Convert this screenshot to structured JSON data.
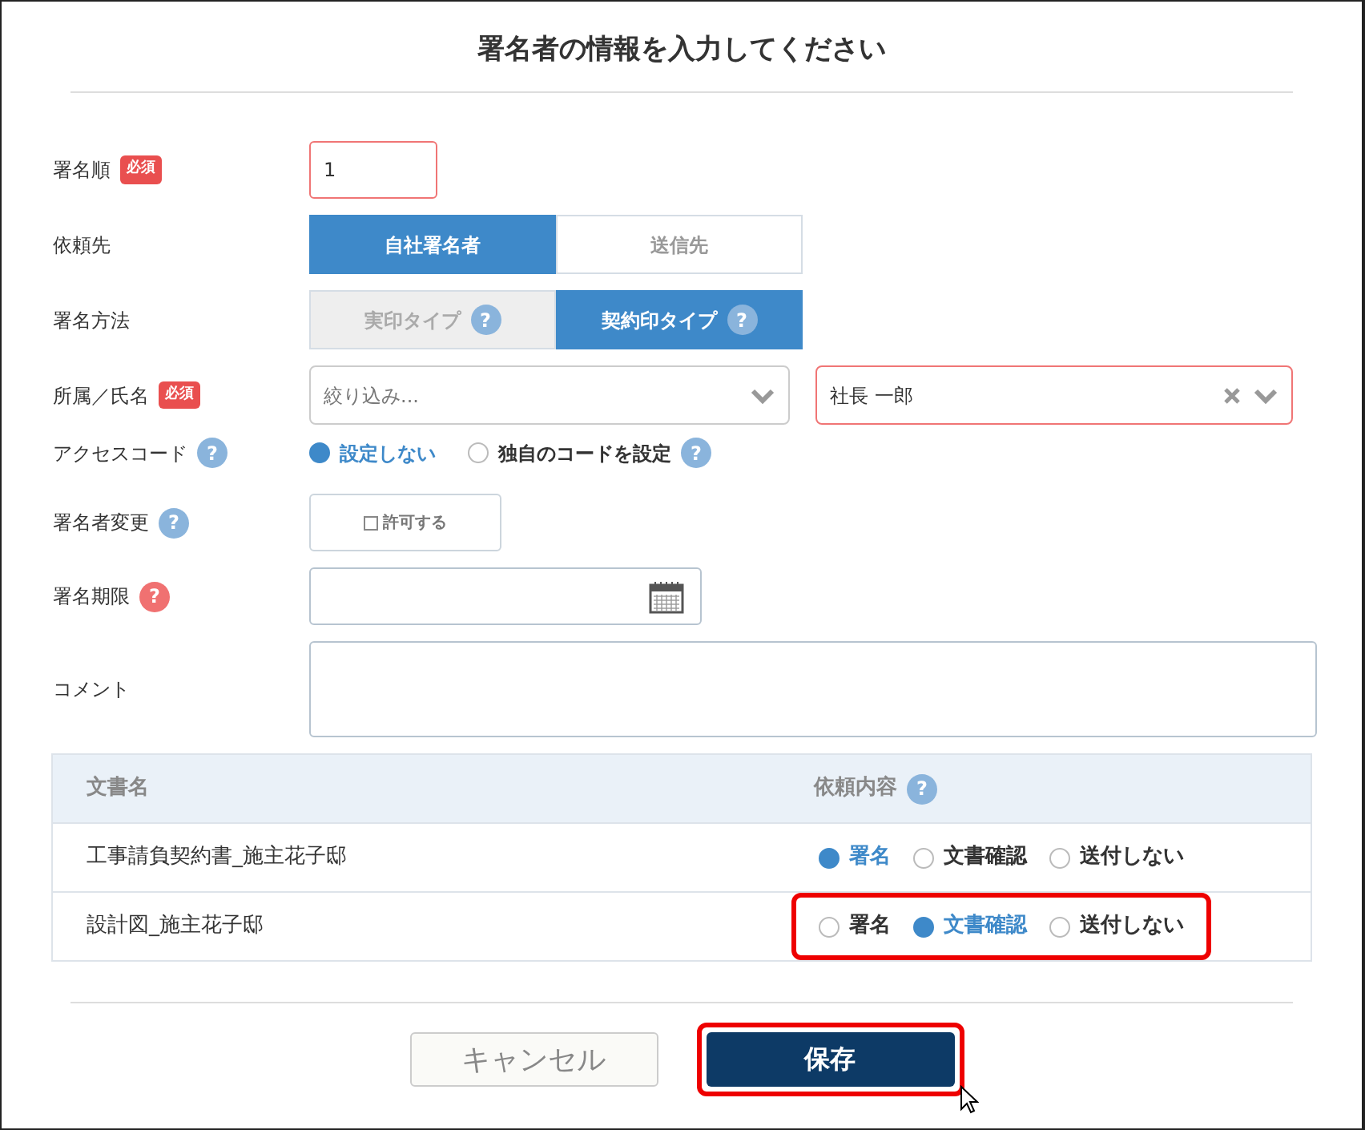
{
  "title": "署名者の情報を入力してください",
  "fields": [
    {
      "kind": "text",
      "label": "署名順",
      "required_label": "必須",
      "value": "1",
      "error": true
    },
    {
      "kind": "segmented",
      "label": "依頼先",
      "options": [
        {
          "label": "自社署名者",
          "selected": true
        },
        {
          "label": "送信先",
          "selected": false
        }
      ]
    },
    {
      "kind": "segmented",
      "label": "署名方法",
      "options": [
        {
          "label": "実印タイプ",
          "selected": false,
          "help": {
            "text": "?",
            "color": "#8ab4dc"
          }
        },
        {
          "label": "契約印タイプ",
          "selected": true,
          "help": {
            "text": "?",
            "color": "#8ab4dc"
          }
        }
      ]
    },
    {
      "kind": "selects",
      "label": "所属／氏名",
      "required_label": "必須",
      "selects": [
        {
          "placeholder": "絞り込み...",
          "error": false,
          "clearable": false
        },
        {
          "value": "社長 一郎",
          "error": true,
          "clearable": true
        }
      ]
    },
    {
      "kind": "radio",
      "label": "アクセスコード",
      "help": {
        "text": "?",
        "color": "#8ab4dc"
      },
      "options": [
        {
          "label": "設定しない",
          "selected": true
        },
        {
          "label": "独自のコードを設定",
          "selected": false,
          "help": {
            "text": "?",
            "color": "#8ab4dc"
          }
        }
      ]
    },
    {
      "kind": "checkbox",
      "label": "署名者変更",
      "help": {
        "text": "?",
        "color": "#8ab4dc"
      },
      "checkbox": {
        "label": "許可する",
        "checked": false
      }
    },
    {
      "kind": "date",
      "label": "署名期限",
      "help": {
        "text": "?",
        "color": "#f07171"
      }
    },
    {
      "kind": "textarea",
      "label": "コメント"
    }
  ],
  "documents": {
    "columns": [
      {
        "label": "文書名"
      },
      {
        "label": "依頼内容",
        "help": {
          "text": "?",
          "color": "#8ab4dc"
        }
      }
    ],
    "rows": [
      {
        "name": "工事請負契約書_施主花子邸",
        "highlighted": false,
        "options": [
          {
            "label": "署名",
            "selected": true
          },
          {
            "label": "文書確認",
            "selected": false
          },
          {
            "label": "送付しない",
            "selected": false
          }
        ]
      },
      {
        "name": "設計図_施主花子邸",
        "highlighted": true,
        "options": [
          {
            "label": "署名",
            "selected": false
          },
          {
            "label": "文書確認",
            "selected": true
          },
          {
            "label": "送付しない",
            "selected": false
          }
        ]
      }
    ]
  },
  "buttons": [
    {
      "label": "キャンセル",
      "kind": "secondary",
      "highlighted": false
    },
    {
      "label": "保存",
      "kind": "primary",
      "highlighted": true
    }
  ]
}
